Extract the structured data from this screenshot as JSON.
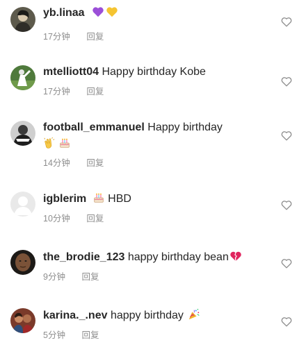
{
  "comments": [
    {
      "username": "yb.linaa",
      "text": "",
      "emoji": [
        "purple-heart",
        "yellow-heart"
      ],
      "time": "17分钟",
      "reply": "回复"
    },
    {
      "username": "mtelliott04",
      "text": "Happy birthday Kobe",
      "time": "17分钟",
      "reply": "回复"
    },
    {
      "username": "football_emmanuel",
      "text": "Happy birthday",
      "emoji": [
        "clapping-hands",
        "birthday-cake"
      ],
      "time": "14分钟",
      "reply": "回复"
    },
    {
      "username": "igblerim",
      "text": "HBD",
      "emoji": [
        "birthday-cake"
      ],
      "time": "10分钟",
      "reply": "回复"
    },
    {
      "username": "the_brodie_123",
      "text": "happy birthday bean",
      "emoji": [
        "broken-heart"
      ],
      "time": "9分钟",
      "reply": "回复"
    },
    {
      "username": "karina._.nev",
      "text": "happy birthday",
      "emoji": [
        "party-popper"
      ],
      "time": "5分钟",
      "reply": "回复"
    }
  ],
  "colors": {
    "text": "#262626",
    "meta": "#8e8e8e",
    "heart_outline": "#8e8e8e"
  }
}
